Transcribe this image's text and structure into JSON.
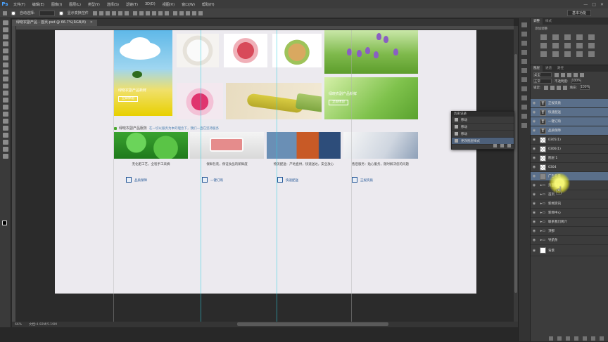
{
  "app": {
    "logo": "Ps"
  },
  "menu": [
    "文件(F)",
    "编辑(E)",
    "图像(I)",
    "图层(L)",
    "类型(Y)",
    "选择(S)",
    "滤镜(T)",
    "3D(D)",
    "视图(V)",
    "窗口(W)",
    "帮助(H)"
  ],
  "window_controls": [
    "—",
    "□",
    "✕"
  ],
  "options": {
    "auto_select_label": "自动选择:",
    "show_transform_label": "显示变换控件",
    "workspace": "基本功能"
  },
  "document_tab": {
    "title": "绿晓农副产品 - 首页.psd @ 66.7%(RGB/8)",
    "close": "✕"
  },
  "status": {
    "zoom": "66%",
    "doc_size": "文档:4.92M/5.19M"
  },
  "canvas": {
    "hero_text": "绿晓农副产品新鲜",
    "hero_button": "立即体验",
    "sprout_text": "绿晓农副产品新鲜",
    "sprout_button": "立即体验",
    "section_title": "绿晓农副产品服务",
    "section_subtitle": "在一切以服务为本的理念下，我们一直在坚持服务",
    "services": [
      "无化肥工艺，全程手工采摘",
      "保鲜包装，保证食品的新鲜度",
      "物流配送：产地直供，快速送达，安全放心",
      "售后服务：贴心服务，随时解决您的问题"
    ],
    "service_icons": [
      {
        "letter": "三",
        "label": "品质保障"
      },
      {
        "letter": "3",
        "label": "一键订购"
      },
      {
        "letter": "三",
        "label": "快速配送"
      },
      {
        "letter": "羊",
        "label": "正规资质"
      }
    ]
  },
  "panels": {
    "tabs": [
      "调整",
      "样式"
    ],
    "adjust_title": "添加调整",
    "layer_tabs": [
      "图层",
      "通道",
      "路径"
    ],
    "kind_label": "类型",
    "blend_mode": "正常",
    "opacity_label": "不透明度:",
    "opacity": "100%",
    "lock_label": "锁定:",
    "fill_label": "填充:",
    "fill": "100%"
  },
  "layers": [
    {
      "name": "正规资质",
      "kind": "text",
      "selected": true
    },
    {
      "name": "快速配送",
      "kind": "text",
      "selected": true
    },
    {
      "name": "一键订购",
      "kind": "text",
      "selected": true
    },
    {
      "name": "品质保障",
      "kind": "text",
      "selected": true
    },
    {
      "name": "0305(1)",
      "kind": "image",
      "selected": false
    },
    {
      "name": "0306(1)",
      "kind": "image",
      "selected": false
    },
    {
      "name": "图层 1",
      "kind": "image",
      "selected": false
    },
    {
      "name": "0304",
      "kind": "image",
      "selected": false
    },
    {
      "name": "广告背景",
      "kind": "bg",
      "selected": true
    },
    {
      "name": "页面部分",
      "kind": "folder",
      "selected": false
    },
    {
      "name": "首页",
      "kind": "folder",
      "selected": false
    },
    {
      "name": "新闻资讯",
      "kind": "folder",
      "selected": false
    },
    {
      "name": "新闻中心",
      "kind": "folder",
      "selected": false
    },
    {
      "name": "联系我们简介",
      "kind": "folder",
      "selected": false
    },
    {
      "name": "顶部",
      "kind": "folder",
      "selected": false
    },
    {
      "name": "导航条",
      "kind": "folder",
      "selected": false
    },
    {
      "name": "背景",
      "kind": "white",
      "selected": false
    }
  ],
  "history": {
    "title": "历史记录",
    "rows": [
      "移动",
      "移动",
      "移动",
      "更改图层样式"
    ]
  }
}
